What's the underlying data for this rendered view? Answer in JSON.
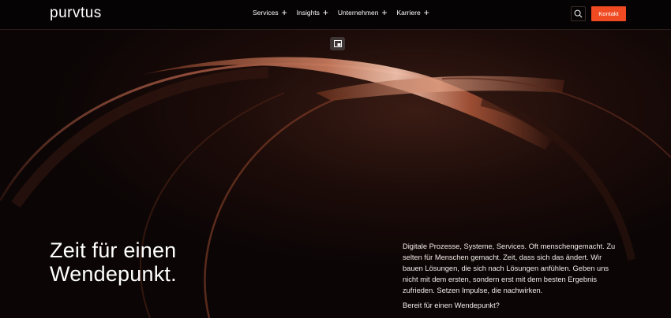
{
  "brand": {
    "logo_text": "purvtus"
  },
  "nav": {
    "items": [
      {
        "label": "Services"
      },
      {
        "label": "Insights"
      },
      {
        "label": "Unternehmen"
      },
      {
        "label": "Karriere"
      }
    ],
    "expand_symbol": "+"
  },
  "header_actions": {
    "contact_label": "Kontakt"
  },
  "hero": {
    "headline_line1": "Zeit für einen",
    "headline_line2": "Wendepunkt.",
    "intro": "Digitale Prozesse, Systeme, Services. Oft menschengemacht. Zu selten für Menschen gemacht. Zeit, dass sich das ändert. Wir bauen Lösungen, die sich nach Lösungen anfühlen. Geben uns nicht mit dem ersten, sondern erst mit dem besten Ergebnis zufrieden. Setzen Impulse, die nachwirken.",
    "cta_text": "Bereit für einen Wendepunkt?"
  },
  "icons": {
    "search": "search-icon",
    "media": "media-toggle-icon"
  },
  "colors": {
    "accent": "#f04a23",
    "background": "#0d0606",
    "header": "#050303"
  }
}
